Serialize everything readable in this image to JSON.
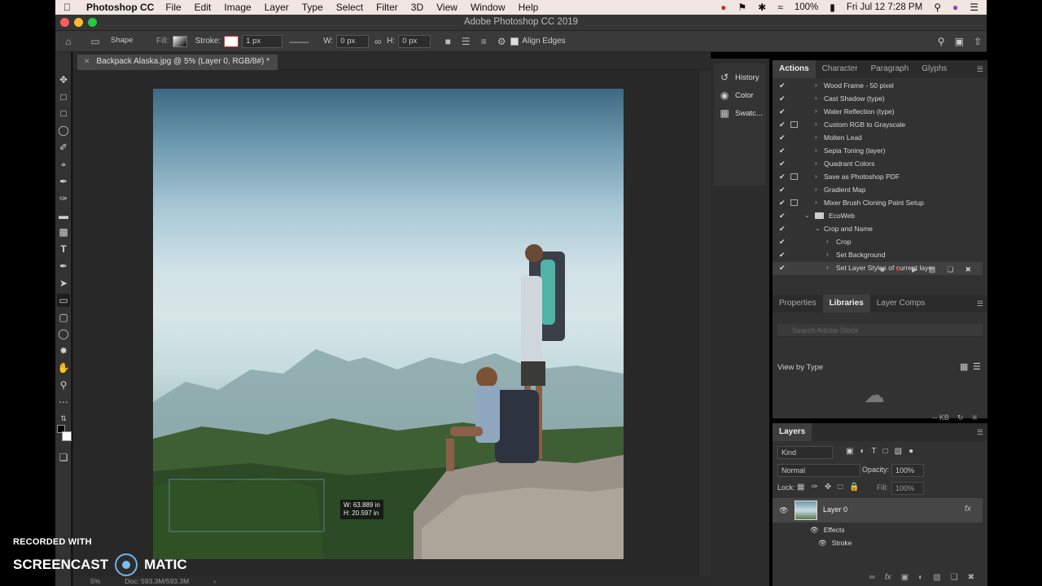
{
  "menubar": {
    "app_name": "Photoshop CC",
    "items": [
      "File",
      "Edit",
      "Image",
      "Layer",
      "Type",
      "Select",
      "Filter",
      "3D",
      "View",
      "Window",
      "Help"
    ],
    "battery": "100%",
    "clock": "Fri Jul 12  7:28 PM"
  },
  "window": {
    "title": "Adobe Photoshop CC 2019"
  },
  "options": {
    "shape_mode": "Shape",
    "fill_label": "Fill:",
    "stroke_label": "Stroke:",
    "stroke_width": "1 px",
    "w_label": "W:",
    "w_value": "0 px",
    "h_label": "H:",
    "h_value": "0 px",
    "align_edges": "Align Edges"
  },
  "document": {
    "tab_title": "Backpack Alaska.jpg @ 5% (Layer 0, RGB/8#) *",
    "zoom": "5%",
    "doc_size": "Doc: 593.3M/593.3M",
    "readout_w": "W: 63.889 in",
    "readout_h": "H: 20.597 in"
  },
  "icon_panels": [
    {
      "label": "History",
      "icon": "history-icon"
    },
    {
      "label": "Color",
      "icon": "color-icon"
    },
    {
      "label": "Swatc...",
      "icon": "swatches-icon"
    }
  ],
  "actions_panel": {
    "tabs": [
      "Actions",
      "Character",
      "Paragraph",
      "Glyphs"
    ],
    "rows": [
      {
        "label": "Wood Frame - 50 pixel",
        "dialog": false
      },
      {
        "label": "Cast Shadow (type)",
        "dialog": false
      },
      {
        "label": "Water Reflection (type)",
        "dialog": false
      },
      {
        "label": "Custom RGB to Grayscale",
        "dialog": true
      },
      {
        "label": "Molten Lead",
        "dialog": false
      },
      {
        "label": "Sepia Toning (layer)",
        "dialog": false
      },
      {
        "label": "Quadrant Colors",
        "dialog": false
      },
      {
        "label": "Save as Photoshop PDF",
        "dialog": true
      },
      {
        "label": "Gradient Map",
        "dialog": false
      },
      {
        "label": "Mixer Brush Cloning Paint Setup",
        "dialog": true
      }
    ],
    "set_name": "EcoWeb",
    "action_name": "Crop and Name",
    "steps": [
      "Crop",
      "Set Background",
      "Set Layer Styles of current layer"
    ]
  },
  "libraries_panel": {
    "tabs": [
      "Properties",
      "Libraries",
      "Layer Comps"
    ],
    "search_placeholder": "Search Adobe Stock",
    "view_by": "View by Type",
    "size": "-- KB"
  },
  "layers_panel": {
    "title": "Layers",
    "filter_kind": "Kind",
    "blend_mode": "Normal",
    "opacity_label": "Opacity:",
    "opacity": "100%",
    "lock_label": "Lock:",
    "fill_label": "Fill:",
    "fill": "100%",
    "layer_name": "Layer 0",
    "effects_label": "Effects",
    "stroke_label": "Stroke"
  },
  "watermark": {
    "recorded_with": "RECORDED WITH",
    "brand_left": "SCREENCAST",
    "brand_right": "MATIC"
  },
  "colors": {
    "record_red": "#e0262a",
    "menubar_bg": "#f1e5e1",
    "panel_bg": "#323232"
  }
}
